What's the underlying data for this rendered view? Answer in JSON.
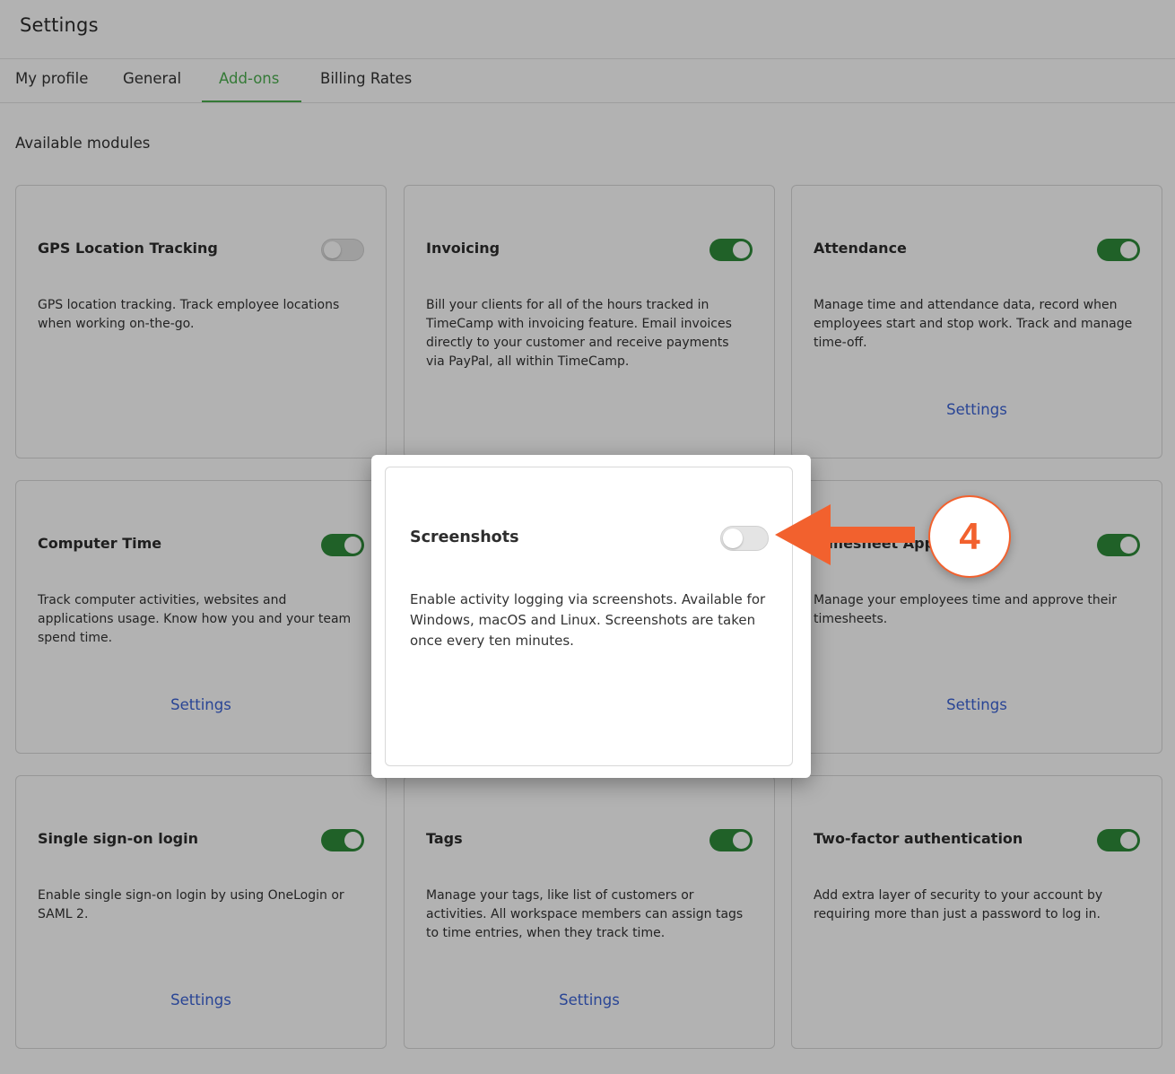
{
  "header": {
    "title": "Settings"
  },
  "tabs": [
    {
      "label": "My profile",
      "active": false
    },
    {
      "label": "General",
      "active": false
    },
    {
      "label": "Add-ons",
      "active": true
    },
    {
      "label": "Billing Rates",
      "active": false
    }
  ],
  "section_title": "Available modules",
  "colors": {
    "accent_green": "#4caf50",
    "toggle_on": "#2e8b3a",
    "link_blue": "#3b63d6",
    "callout_orange": "#f2612e"
  },
  "modules": [
    {
      "title": "GPS Location Tracking",
      "enabled": false,
      "description": "GPS location tracking. Track employee locations when working on-the-go.",
      "settings_label": ""
    },
    {
      "title": "Invoicing",
      "enabled": true,
      "description": "Bill your clients for all of the hours tracked in TimeCamp with invoicing feature. Email invoices directly to your customer and receive payments via PayPal, all within TimeCamp.",
      "settings_label": ""
    },
    {
      "title": "Attendance",
      "enabled": true,
      "description": "Manage time and attendance data, record when employees start and stop work. Track and manage time-off.",
      "settings_label": "Settings"
    },
    {
      "title": "Computer Time",
      "enabled": true,
      "description": "Track computer activities, websites and applications usage. Know how you and your team spend time.",
      "settings_label": "Settings"
    },
    {
      "title": "Timesheet Approvals",
      "enabled": true,
      "description": "Manage your employees time and approve their timesheets.",
      "settings_label": "Settings"
    },
    {
      "title": "Single sign-on login",
      "enabled": true,
      "description": "Enable single sign-on login by using OneLogin or SAML 2.",
      "settings_label": "Settings"
    },
    {
      "title": "Tags",
      "enabled": true,
      "description": "Manage your tags, like list of customers or activities. All workspace members can assign tags to time entries, when they track time.",
      "settings_label": "Settings"
    },
    {
      "title": "Two-factor authentication",
      "enabled": true,
      "description": "Add extra layer of security to your account by requiring more than just a password to log in.",
      "settings_label": ""
    }
  ],
  "modal": {
    "title": "Screenshots",
    "enabled": false,
    "description": "Enable activity logging via screenshots. Available for Windows, macOS and Linux. Screenshots are taken once every ten minutes."
  },
  "callout": {
    "step_number": "4",
    "icon": "arrow-left-icon"
  }
}
